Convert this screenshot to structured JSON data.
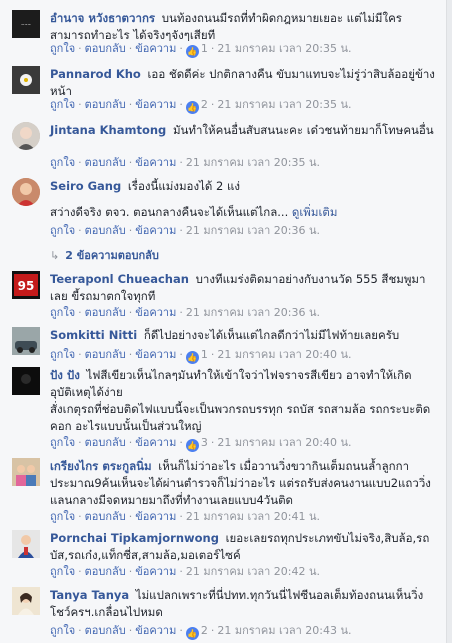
{
  "actions": {
    "like": "ถูกใจ",
    "reply": "ตอบกลับ",
    "message": "ข้อความ",
    "sep": "·"
  },
  "comments": [
    {
      "name": "อำนาจ หวังธาตวากร",
      "text": "บนท้องถนนมีรถที่ทำผิดกฎหมายเยอะ แต่ไม่มีใครสามารถทำอะไร ได้จริงๆจังๆเสียที",
      "reactions": "1",
      "time": "21 มกราคม เวลา 20:35 น.",
      "avatar_color": "#1c1c1c"
    },
    {
      "name": "Pannarod Kho",
      "text": "เออ ชัดดีค่ะ ปกติกลางคืน ขับมาแทบจะไม่รู่ว่าสิบล้ออยู่ข้างหน้า",
      "reactions": "2",
      "time": "21 มกราคม เวลา 20:35 น.",
      "avatar_color": "#3a3a3a"
    },
    {
      "name": "Jintana Khamtong",
      "text": "มันทำให้คนอื่นสับสนนะคะ เด๋วชนท้ายมาก็โทษคนอื่น",
      "reactions": "",
      "time": "21 มกราคม เวลา 20:35 น.",
      "avatar_color": "#b9b3ad"
    },
    {
      "name": "Seiro Gang",
      "text": "เรื่องนี้แม่งมองได้ 2 แง่",
      "text2": "สว่างดีจริง ตจว. ตอนกลางคืนจะได้เห็นแต่ไกล...",
      "more": "ดูเพิ่มเติม",
      "reactions": "",
      "time": "21 มกราคม เวลา 20:36 น.",
      "avatar_color": "#c98a6b",
      "replies_label": "2 ข้อความตอบกลับ"
    },
    {
      "name": "Teeraponl Chueachan",
      "text": "บางทีแมร่งติดมาอย่างกับงานวัด 555 สีชมพูมาเลย ขี้รถมาตกใจทุกที",
      "reactions": "",
      "time": "21 มกราคม เวลา 20:36 น.",
      "avatar_color": "#b8121b",
      "avatar_text": "95"
    },
    {
      "name": "Somkitti Nitti",
      "text": "ก็ดีไปอย่างจะได้เห็นแต่ไกลดีกว่าไม่มีไฟท้ายเลยครับ",
      "reactions": "1",
      "time": "21 มกราคม เวลา 20:40 น.",
      "avatar_color": "#7f8a8c"
    },
    {
      "name": "ปัง ปัง",
      "text": "ไฟสีเขียวเห็นไกลๆมันทำให้เข้าใจว่าไฟจราจรสีเขียว อาจทำให้เกิดอุบัติเหตุได้ง่าย",
      "text2": "สั่งเกตุรถที่ช่อบติดไฟแบบนี้จะเป็นพวกรถบรรทุก รถบัส รถสามล้อ รถกระบะติดคอก อะไรแบบนั้นเป็นส่วนใหญ่",
      "reactions": "3",
      "time": "21 มกราคม เวลา 20:40 น.",
      "avatar_color": "#101010"
    },
    {
      "name": "เกรียงไกร ตระกูลนิ่ม",
      "text": "เห็นก็ไม่ว่าอะไร เมื่อวานวิ่งขวากินเต็มถนนล้ำลูกกาประมาณ9ค้นเห็นจะได้ผ่านตำรวจก็ไม่ว่าอะไร แต่รถรับส่งคนงานแบบ2แถววิ่งแลนกลางมีจดหมายมาถึงที่ทำงานเลยแบบ4วันติด",
      "reactions": "",
      "time": "21 มกราคม เวลา 20:41 น.",
      "avatar_color": "#c7a27a"
    },
    {
      "name": "Pornchai Tipkamjornwong",
      "text": "เยอะเลยรถทุกประเภทขับไม่จริง,สิบล้อ,รถบัส,รถเก๋ง,แท็กซี่ส,สามล้อ,มอเตอร์ไซค์",
      "reactions": "",
      "time": "21 มกราคม เวลา 20:42 น.",
      "avatar_color": "#d9d9d9"
    },
    {
      "name": "Tanya Tanya",
      "text": "ไม่แปลกเพราะที่นี่ปทท.ทุกวันนี่ไฟซีนอลเต็มท้องถนนเห็นวิ่งโชว์ครฯ.เกลื่อนไปหมด",
      "reactions": "2",
      "time": "21 มกราคม เวลา 20:43 น.",
      "avatar_color": "#e8dcc5"
    }
  ]
}
